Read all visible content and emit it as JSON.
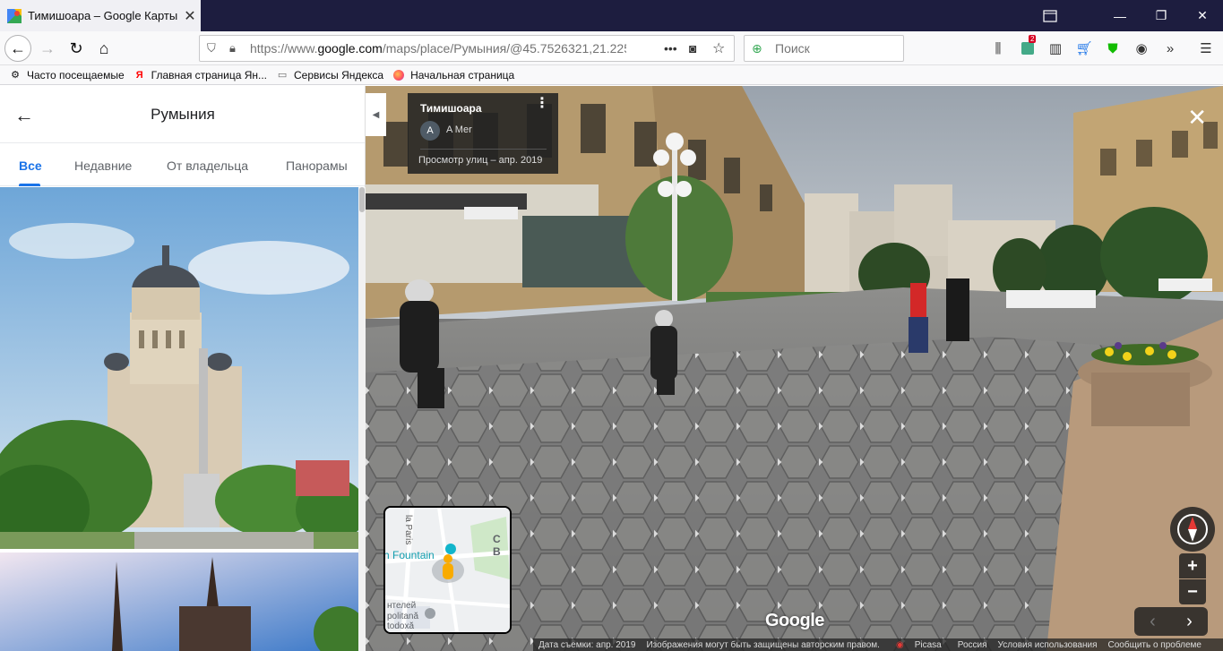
{
  "browser": {
    "tab_title": "Тимишоара – Google Карты",
    "url_prefix": "https://www.",
    "url_domain": "google.com",
    "url_path": "/maps/place/Румыния/@45.7526321,21.225",
    "search_placeholder": "Поиск",
    "library_badge": "2",
    "bookmarks": [
      {
        "label": "Часто посещаемые",
        "icon": "gear-icon"
      },
      {
        "label": "Главная страница Ян...",
        "icon": "yandex-icon"
      },
      {
        "label": "Сервисы Яндекса",
        "icon": "folder-icon"
      },
      {
        "label": "Начальная страница",
        "icon": "firefox-icon"
      }
    ]
  },
  "panel": {
    "title": "Румыния",
    "tabs": [
      "Все",
      "Недавние",
      "От владельца",
      "Панорамы"
    ],
    "active_tab": "Все"
  },
  "streetview": {
    "place": "Тимишоара",
    "author_initial": "A",
    "author": "A Mer",
    "date": "Просмотр улиц – апр. 2019",
    "google_logo": "Google",
    "minimap": {
      "label_paris": "la Paris",
      "label_fountain": "h Fountain",
      "label_c": "C B",
      "label_bottom1": "нтелей",
      "label_bottom2": "politană",
      "label_bottom3": "todoxă"
    },
    "footer": {
      "capture_date": "Дата съемки: апр. 2019",
      "copyright": "Изображения могут быть защищены авторским правом.",
      "picasa": "Picasa",
      "country": "Россия",
      "terms": "Условия использования",
      "report": "Сообщить о проблеме"
    }
  }
}
